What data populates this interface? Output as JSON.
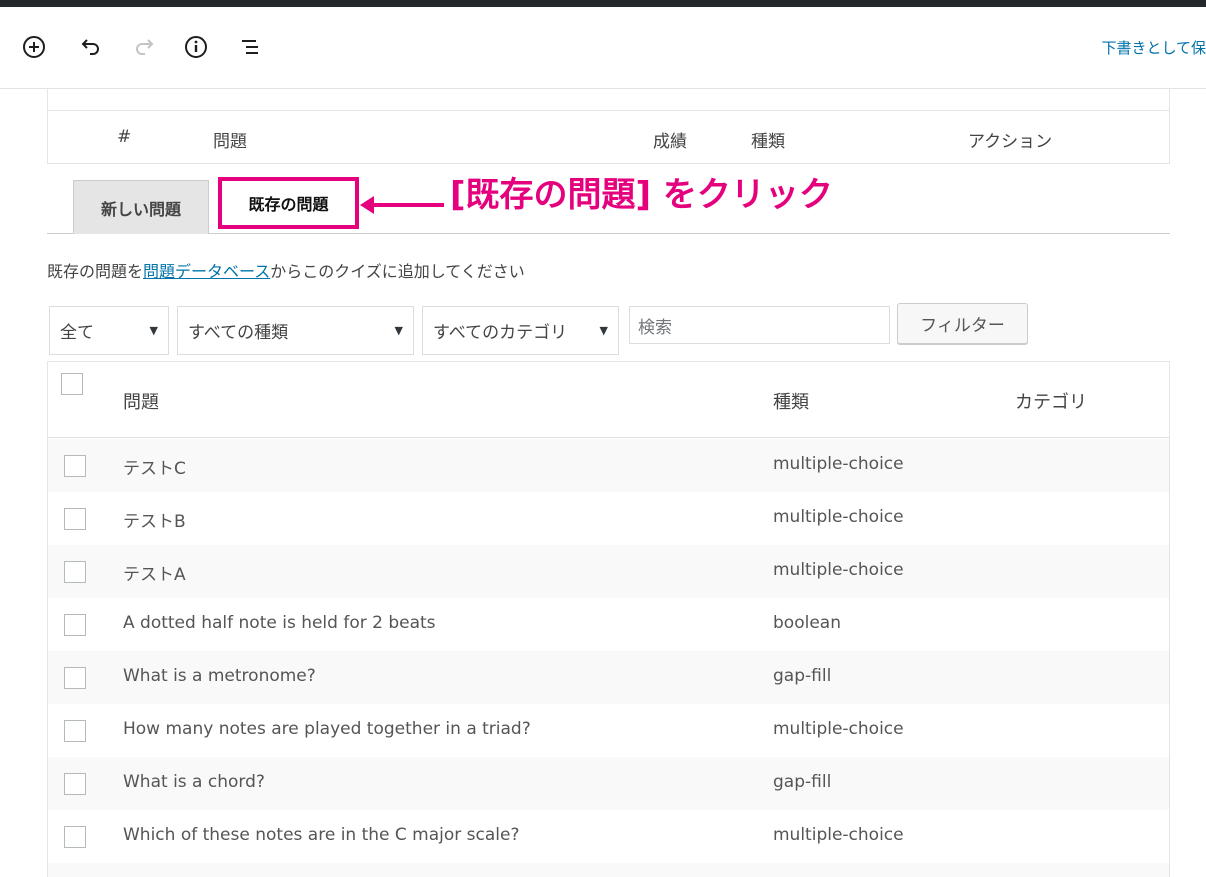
{
  "toolbar": {
    "save_draft": "下書きとして保",
    "icons": [
      "add-block-icon",
      "undo-icon",
      "redo-icon",
      "info-icon",
      "outline-icon"
    ]
  },
  "quiz_table": {
    "headers": [
      "#",
      "問題",
      "成績",
      "種類",
      "アクション"
    ]
  },
  "tabs": {
    "new": "新しい問題",
    "existing": "既存の問題"
  },
  "annotation": {
    "text": "[既存の問題] をクリック",
    "color": "#e5007e"
  },
  "intro": {
    "prefix": "既存の問題を",
    "link": "問題データベース",
    "suffix": "からこのクイズに追加してください"
  },
  "filters": {
    "all": "全て",
    "types": "すべての種類",
    "categories": "すべてのカテゴリ",
    "search_placeholder": "検索",
    "filter_button": "フィルター"
  },
  "list": {
    "headers": [
      "問題",
      "種類",
      "カテゴリ"
    ],
    "rows": [
      {
        "question": "テストC",
        "type": "multiple-choice"
      },
      {
        "question": "テストB",
        "type": "multiple-choice"
      },
      {
        "question": "テストA",
        "type": "multiple-choice"
      },
      {
        "question": "A dotted half note is held for 2 beats",
        "type": "boolean"
      },
      {
        "question": "What is a metronome?",
        "type": "gap-fill"
      },
      {
        "question": "How many notes are played together in a triad?",
        "type": "multiple-choice"
      },
      {
        "question": "What is a chord?",
        "type": "gap-fill"
      },
      {
        "question": "Which of these notes are in the C major scale?",
        "type": "multiple-choice"
      }
    ]
  },
  "colors": {
    "accent": "#e5007e",
    "link": "#0073aa",
    "topbar": "#23282d"
  }
}
